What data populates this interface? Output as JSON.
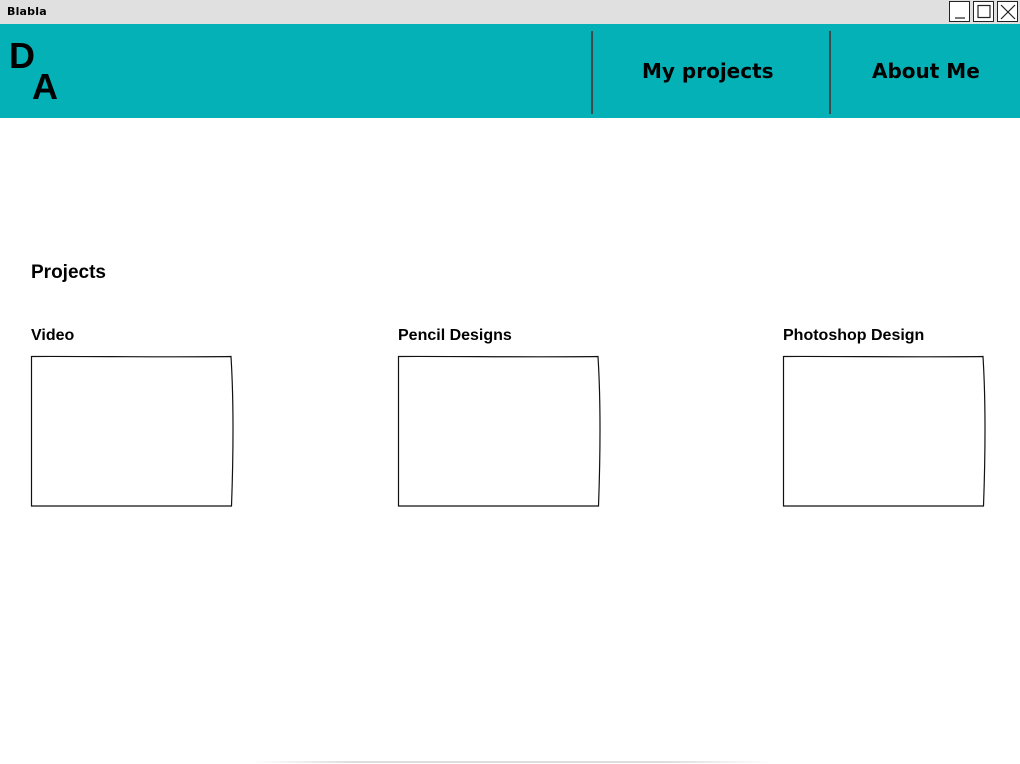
{
  "window": {
    "title": "Blabla",
    "controls": [
      "minimize-icon",
      "maximize-icon",
      "close-icon"
    ]
  },
  "header": {
    "background": "#03b1b7",
    "logo": {
      "first_letter": "D",
      "second_letter": "A"
    },
    "nav": [
      {
        "label": "My projects"
      },
      {
        "label": "About Me"
      }
    ]
  },
  "main": {
    "section_title": "Projects",
    "cards": [
      {
        "label": "Video"
      },
      {
        "label": "Pencil Designs"
      },
      {
        "label": "Photoshop Design"
      }
    ]
  }
}
